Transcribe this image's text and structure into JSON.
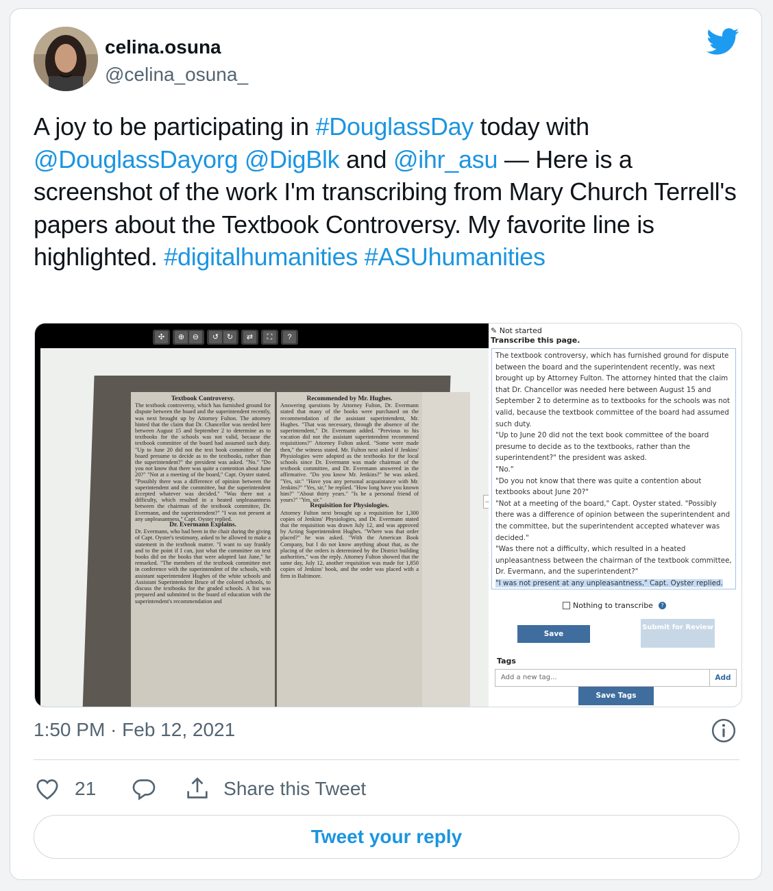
{
  "user": {
    "display_name": "celina.osuna",
    "handle": "@celina_osuna_"
  },
  "tweet": {
    "segments": [
      {
        "text": "A joy to be participating in ",
        "link": false
      },
      {
        "text": "#DouglassDay",
        "link": true
      },
      {
        "text": " today with ",
        "link": false
      },
      {
        "text": "@DouglassDayorg",
        "link": true
      },
      {
        "text": " ",
        "link": false
      },
      {
        "text": "@DigBlk",
        "link": true
      },
      {
        "text": " and ",
        "link": false
      },
      {
        "text": "@ihr_asu",
        "link": true
      },
      {
        "text": " — Here is a screenshot of the work I'm transcribing from Mary Church Terrell's papers about the Textbook Controversy. My favorite line is highlighted. ",
        "link": false
      },
      {
        "text": "#digitalhumanities",
        "link": true
      },
      {
        "text": " ",
        "link": false
      },
      {
        "text": "#ASUhumanities",
        "link": true
      }
    ],
    "timestamp": "1:50 PM · Feb 12, 2021",
    "like_count": "21",
    "share_label": "Share this Tweet",
    "reply_label": "Tweet your reply"
  },
  "colors": {
    "link": "#1b95e0",
    "muted": "#536471",
    "border": "#cfd9de",
    "save_button": "#3f6d9e"
  },
  "screenshot": {
    "toolbar_icons": [
      "move-icon",
      "zoom-in-icon",
      "zoom-out-icon",
      "rotate-left-icon",
      "rotate-right-icon",
      "swap-icon",
      "fullscreen-icon",
      "help-icon"
    ],
    "newspaper": {
      "left_head": "Textbook Controversy.",
      "left_text": "The textbook controversy, which has furnished ground for dispute between the board and the superintendent recently, was next brought up by Attorney Fulton. The attorney hinted that the claim that Dr. Chancellor was needed here between August 15 and September 2 to determine as to textbooks for the schools was not valid, because the textbook committee of the board had assumed such duty. \"Up to June 20 did not the text book committee of the board presume to decide as to the textbooks, rather than the superintendent?\" the president was asked. \"No.\" \"Do you not know that there was quite a contention about June 20?\" \"Not at a meeting of the board,\" Capt. Oyster stated. \"Possibly there was a difference of opinion between the superintendent and the committee, but the superintendent accepted whatever was decided.\" \"Was there not a difficulty, which resulted in a heated unpleasantness between the chairman of the textbook committee, Dr. Evermann, and the superintendent?\" \"I was not present at any unpleasantness,\" Capt. Oyster replied.",
      "left_head2": "Dr. Evermann Explains.",
      "left_text2": "Dr. Evermann, who had been in the chair during the giving of Capt. Oyster's testimony, asked to be allowed to make a statement in the textbook matter. \"I want to say frankly and to the point if I can, just what the committee on text books did on the books that were adopted last June,\" he remarked. \"The members of the textbook committee met in conference with the superintendent of the schools, with assistant superintendent Hughes of the white schools and Assistant Superintendent Bruce of the colored schools, to discuss the textbooks for the graded schools. A list was prepared and submitted to the board of education with the superintendent's recommendation and",
      "right_head": "Recommended by Mr. Hughes.",
      "right_text": "Answering questions by Attorney Fulton, Dr. Evermann stated that many of the books were purchased on the recommendation of the assistant superintendent, Mr. Hughes. \"That was necessary, through the absence of the superintendent,\" Dr. Evermann added. \"Previous to his vacation did not the assistant superintendent recommend requisitions?\" Attorney Fulton asked. \"Some were made then,\" the witness stated. Mr. Fulton next asked if Jenkins' Physiologies were adopted as the textbooks for the local schools since Dr. Evermann was made chairman of the textbook committee, and Dr. Evermann answered in the affirmative. \"Do you know Mr. Jenkins?\" he was asked. \"Yes, sir.\" \"Have you any personal acquaintance with Mr. Jenkins?\" \"Yes, sir,\" he replied. \"How long have you known him?\" \"About thirty years.\" \"Is he a personal friend of yours?\" \"Yes, sir.\"",
      "right_head2": "Requisition for Physiologies.",
      "right_text2": "Attorney Fulton next brought up a requisition for 1,300 copies of Jenkins' Physiologies, and Dr. Evermann stated that the requisition was drawn July 12, and was approved by Acting Superintendent Hughes. \"Where was that order placed?\" he was asked. \"With the American Book Company, but I do not know anything about that, as the placing of the orders is determined by the District building authorities,\" was the reply. Attorney Fulton showed that the same day, July 12, another requisition was made for 1,850 copies of Jenkins' book, and the order was placed with a firm in Baltimore."
    },
    "panel": {
      "status": "Not started",
      "heading": "Transcribe this page.",
      "transcription": [
        "The textbook controversy, which has furnished ground for dispute between the board and the superintendent recently, was next brought up by Attorney Fulton. The attorney hinted that the claim that Dr. Chancellor was needed here between August 15 and September 2 to determine as to textbooks for the schools was not valid, because the textbook committee of the board had assumed such duty.",
        "\"Up to June 20 did not the text book committee of the board presume to decide as to the textbooks, rather than the superintendent?\" the president was asked.",
        "\"No.\"",
        "\"Do you not know that there was quite a contention about textbooks about June 20?\"",
        "\"Not at a meeting of the board,\" Capt. Oyster stated. \"Possibly there was a difference of opinion between the superintendent and the committee, but the superintendent accepted whatever was decided.\"",
        "\"Was there not a difficulty, which resulted in a heated unpleasantness between the chairman of the textbook committee, Dr. Evermann, and the superintendent?\""
      ],
      "highlighted_line": "\"I was not present at any unpleasantness,\" Capt. Oyster replied.",
      "nothing_label": "Nothing to transcribe",
      "save_label": "Save",
      "submit_label": "Submit for Review",
      "tags_label": "Tags",
      "tag_placeholder": "Add a new tag...",
      "add_label": "Add",
      "save_tags_label": "Save Tags"
    }
  }
}
